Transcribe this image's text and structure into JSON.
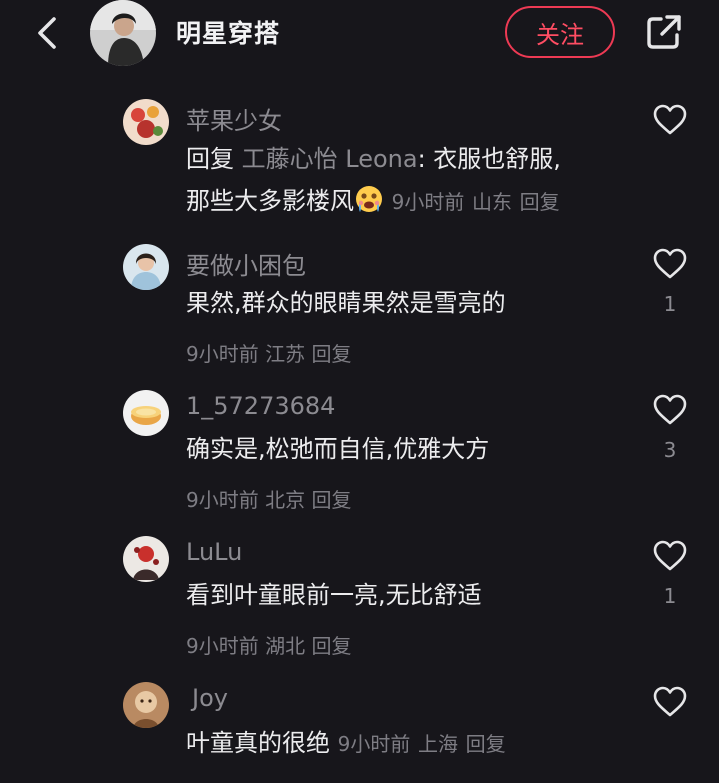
{
  "header": {
    "title": "明星穿搭",
    "follow_label": "关注"
  },
  "comments": [
    {
      "username": "苹果少女",
      "reply_prefix": "回复",
      "mention": "工藤心怡 Leona",
      "text_line1": ": 衣服也舒服,",
      "text_line2": "那些大多影楼风",
      "time": "9小时前",
      "location": "山东",
      "reply": "回复",
      "likes": "",
      "emoji": "crying-face-emoji"
    },
    {
      "username": "要做小困包",
      "text": "果然,群众的眼睛果然是雪亮的",
      "time": "9小时前",
      "location": "江苏",
      "reply": "回复",
      "likes": "1"
    },
    {
      "username": "1_57273684",
      "text": "确实是,松弛而自信,优雅大方",
      "time": "9小时前",
      "location": "北京",
      "reply": "回复",
      "likes": "3"
    },
    {
      "username": "LuLu",
      "text": "看到叶童眼前一亮,无比舒适",
      "time": "9小时前",
      "location": "湖北",
      "reply": "回复",
      "likes": "1"
    },
    {
      "username": "Joy",
      "text": "叶童真的很绝",
      "time": "9小时前",
      "location": "上海",
      "reply": "回复",
      "likes": ""
    }
  ],
  "colors": {
    "background": "#17161b",
    "accent": "#ee3a54",
    "muted": "#8c8b91"
  },
  "icons": [
    "back-arrow-icon",
    "share-icon",
    "heart-icon"
  ]
}
